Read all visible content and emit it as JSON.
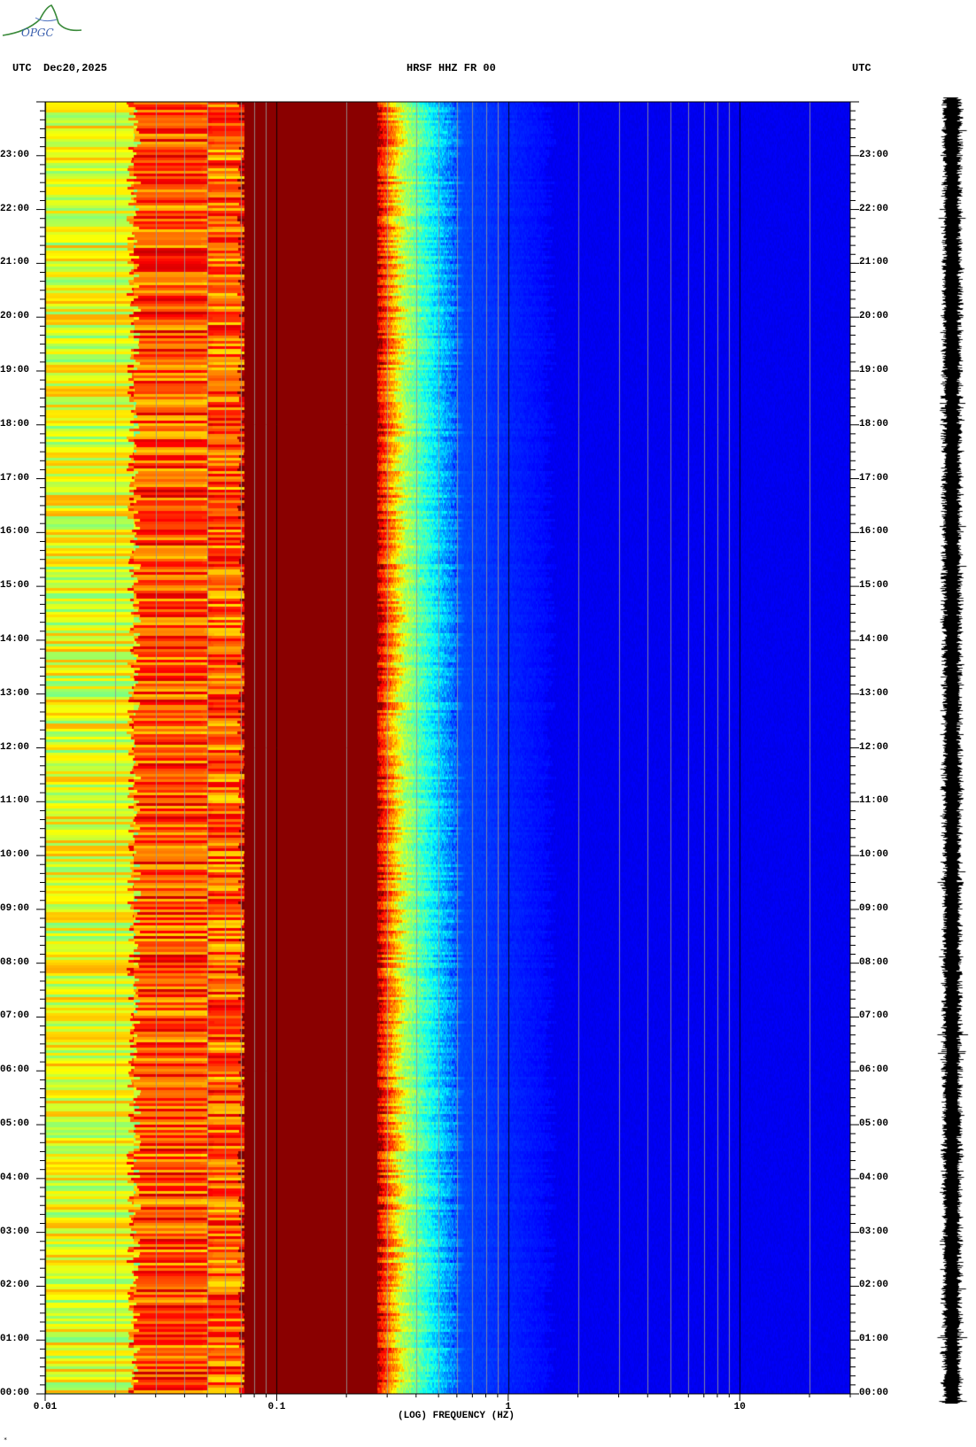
{
  "header": {
    "left_tz": "UTC",
    "date": "Dec20,2025",
    "station": "HRSF HHZ FR 00",
    "right_tz": "UTC"
  },
  "logo": {
    "text": "OPGC",
    "icon": "opgc-volcano-logo"
  },
  "footnote": "*",
  "chart_data": {
    "type": "heatmap",
    "title": "HRSF HHZ FR 00",
    "xlabel": "(LOG) FREQUENCY (HZ)",
    "ylabel": "",
    "x_scale": "log",
    "xlim": [
      0.01,
      30
    ],
    "ylim": [
      0,
      24
    ],
    "x_ticks": [
      {
        "value": 0.01,
        "label": "0.01"
      },
      {
        "value": 0.1,
        "label": "0.1"
      },
      {
        "value": 1,
        "label": "1"
      },
      {
        "value": 10,
        "label": "10"
      }
    ],
    "y_ticks": [
      {
        "value": 0,
        "label": "00:00"
      },
      {
        "value": 1,
        "label": "01:00"
      },
      {
        "value": 2,
        "label": "02:00"
      },
      {
        "value": 3,
        "label": "03:00"
      },
      {
        "value": 4,
        "label": "04:00"
      },
      {
        "value": 5,
        "label": "05:00"
      },
      {
        "value": 6,
        "label": "06:00"
      },
      {
        "value": 7,
        "label": "07:00"
      },
      {
        "value": 8,
        "label": "08:00"
      },
      {
        "value": 9,
        "label": "09:00"
      },
      {
        "value": 10,
        "label": "10:00"
      },
      {
        "value": 11,
        "label": "11:00"
      },
      {
        "value": 12,
        "label": "12:00"
      },
      {
        "value": 13,
        "label": "13:00"
      },
      {
        "value": 14,
        "label": "14:00"
      },
      {
        "value": 15,
        "label": "15:00"
      },
      {
        "value": 16,
        "label": "16:00"
      },
      {
        "value": 17,
        "label": "17:00"
      },
      {
        "value": 18,
        "label": "18:00"
      },
      {
        "value": 19,
        "label": "19:00"
      },
      {
        "value": 20,
        "label": "20:00"
      },
      {
        "value": 21,
        "label": "21:00"
      },
      {
        "value": 22,
        "label": "22:00"
      },
      {
        "value": 23,
        "label": "23:00"
      }
    ],
    "grid": true,
    "colormap": "jet",
    "colors": {
      "background": "#00008f",
      "deep_blue": "#0000c8",
      "blue": "#0050ff",
      "cyan": "#00e0ff",
      "green_cyan": "#40ffc0",
      "yellow": "#ffff00",
      "orange": "#ff9000",
      "red": "#ff2000",
      "dark_red": "#800000"
    },
    "bands": [
      {
        "freq_start": 0.01,
        "freq_end": 0.024,
        "level": "yellow-green"
      },
      {
        "freq_start": 0.024,
        "freq_end": 0.05,
        "level": "orange-red"
      },
      {
        "freq_start": 0.05,
        "freq_end": 0.072,
        "level": "red-orange"
      },
      {
        "freq_start": 0.072,
        "freq_end": 0.1,
        "level": "dark-red"
      },
      {
        "freq_start": 0.1,
        "freq_end": 0.27,
        "level": "dark-red"
      },
      {
        "freq_start": 0.27,
        "freq_end": 0.34,
        "level": "red-yellow"
      },
      {
        "freq_start": 0.34,
        "freq_end": 0.5,
        "level": "cyan-blue"
      },
      {
        "freq_start": 0.5,
        "freq_end": 30,
        "level": "deep-blue"
      }
    ]
  }
}
